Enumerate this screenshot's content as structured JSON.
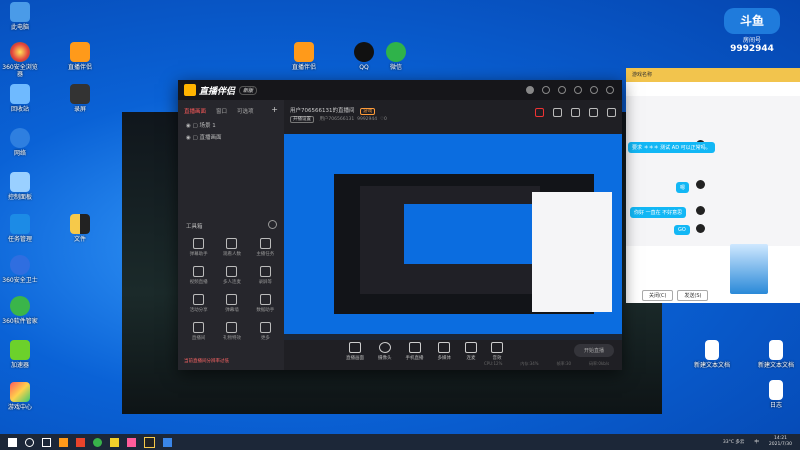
{
  "desktop_icons": [
    {
      "label": "此电脑",
      "color": "#4a9be8"
    },
    {
      "label": "回收站",
      "color": "#6fbaff"
    },
    {
      "label": "微信",
      "color": "#2fb34a"
    },
    {
      "label": "QQ",
      "color": "#111111"
    },
    {
      "label": "直播伴侣",
      "color": "#ff9a1a"
    },
    {
      "label": "录屏",
      "color": "#333333"
    }
  ],
  "badge": {
    "brand": "斗鱼",
    "room_label": "房间号",
    "room_number": "9992944"
  },
  "app": {
    "title": "直播伴侣",
    "version": "新版",
    "tabs": [
      "直播画面",
      "窗口",
      "可选项"
    ],
    "scenes": [
      "场景 1",
      "直播画面"
    ],
    "tools_title": "工具箱",
    "tools": [
      "弹幕助手",
      "观看人数",
      "主播任务",
      "视频直播",
      "多人连麦",
      "录屏等",
      "活动分享",
      "弹幕墙",
      "数据助手",
      "直播间",
      "礼物特效",
      "更多"
    ],
    "warning": "当前直播间分辨率过低",
    "room_title": "用户706566131的直播间",
    "room_tag": "游戏",
    "room_edit": "开播设置",
    "room_user": "用户706566131",
    "room_id": "9992944",
    "room_count": "0",
    "controls": [
      "直播画面",
      "摄像头",
      "手机直播",
      "多媒体",
      "连麦",
      "音效"
    ],
    "start_button": "开始直播",
    "status": [
      "CPU:12%",
      "内存:34%",
      "帧率:30",
      "码率:0kb/s"
    ]
  },
  "chat": {
    "title": "游戏名称",
    "messages": [
      "要求 ＊＊＊ 测试 AD 可以正常吗。",
      "嗯",
      "你好 一直在 不好意思",
      "GO"
    ],
    "close_label": "关闭(C)",
    "send_label": "发送(S)"
  },
  "desktop_files": [
    {
      "label": "新建文本文档"
    },
    {
      "label": "新建文本文档"
    },
    {
      "label": "日志"
    }
  ],
  "taskbar": {
    "weather": "33°C 多云",
    "time": "14:21",
    "date": "2021/7/30",
    "lang": "中"
  }
}
